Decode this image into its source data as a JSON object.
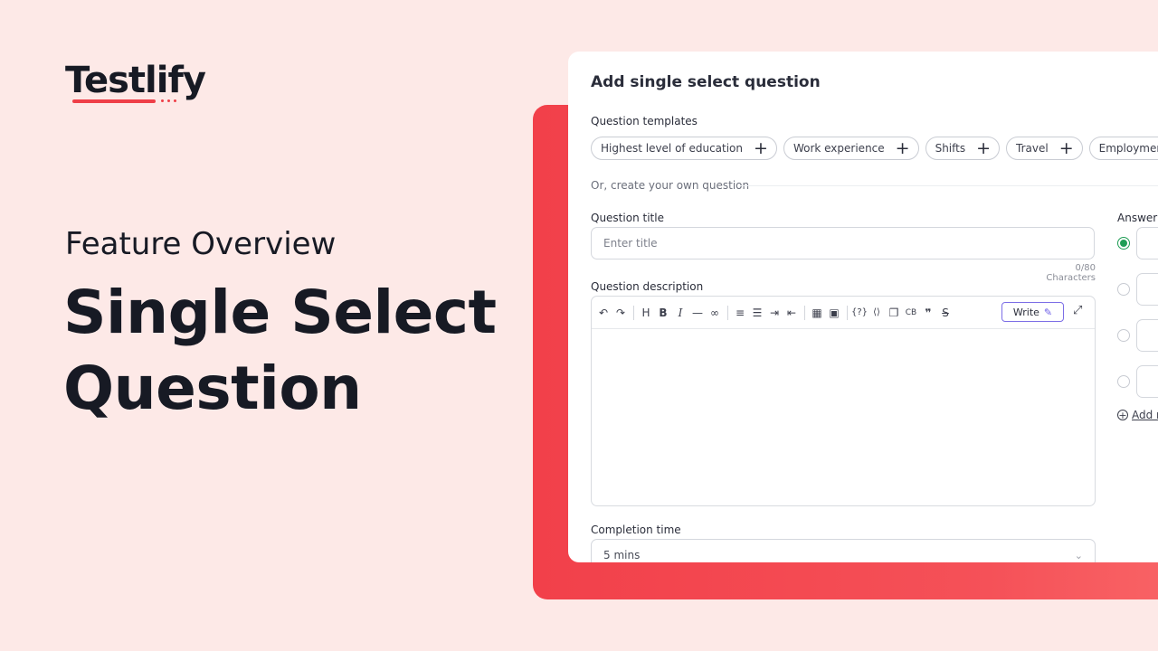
{
  "brand": {
    "logo_text": "Testlify"
  },
  "hero": {
    "subtitle": "Feature Overview",
    "headline_line1": "Single Select",
    "headline_line2": "Question"
  },
  "dialog": {
    "title": "Add single select question",
    "templates_label": "Question templates",
    "templates": [
      "Highest level of education",
      "Work experience",
      "Shifts",
      "Travel",
      "Employment status"
    ],
    "or_text": "Or, create your own question",
    "question_title": {
      "label": "Question title",
      "placeholder": "Enter title",
      "counter": "0/80 Characters"
    },
    "description": {
      "label": "Question description",
      "write_label": "Write",
      "toolbar": [
        "undo-icon",
        "redo-icon",
        "heading-icon",
        "bold-icon",
        "italic-icon",
        "horizontal-rule-icon",
        "link-icon",
        "ordered-list-icon",
        "bullet-list-icon",
        "indent-icon",
        "outdent-icon",
        "table-icon",
        "image-icon",
        "variable-icon",
        "code-icon",
        "copy-icon",
        "codeblock-icon",
        "quote-icon",
        "strikethrough-icon"
      ]
    },
    "completion_time": {
      "label": "Completion time",
      "value": "5 mins"
    },
    "answers": {
      "label": "Answer o",
      "add_more": "Add m"
    }
  },
  "colors": {
    "accent_red": "#ef3f48",
    "selected_green": "#1f9d55",
    "write_border": "#7c6ee6"
  }
}
